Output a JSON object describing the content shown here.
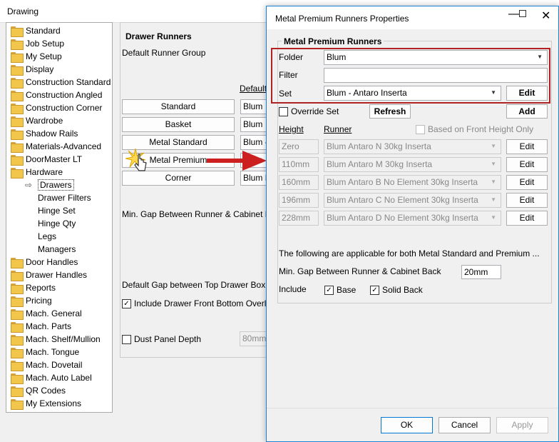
{
  "window": {
    "title": "Drawing"
  },
  "tree": {
    "items": [
      {
        "label": "Standard",
        "type": "folder"
      },
      {
        "label": "Job Setup",
        "type": "folder"
      },
      {
        "label": "My Setup",
        "type": "folder"
      },
      {
        "label": "Display",
        "type": "folder"
      },
      {
        "label": "Construction Standard",
        "type": "folder"
      },
      {
        "label": "Construction Angled",
        "type": "folder"
      },
      {
        "label": "Construction Corner",
        "type": "folder"
      },
      {
        "label": "Wardrobe",
        "type": "folder"
      },
      {
        "label": "Shadow Rails",
        "type": "folder"
      },
      {
        "label": "Materials-Advanced",
        "type": "folder"
      },
      {
        "label": "DoorMaster LT",
        "type": "folder"
      },
      {
        "label": "Hardware",
        "type": "folder"
      },
      {
        "label": "Drawers",
        "type": "child-selected"
      },
      {
        "label": "Drawer Filters",
        "type": "child"
      },
      {
        "label": "Hinge Set",
        "type": "child"
      },
      {
        "label": "Hinge Qty",
        "type": "child"
      },
      {
        "label": "Legs",
        "type": "child"
      },
      {
        "label": "Managers",
        "type": "child"
      },
      {
        "label": "Door Handles",
        "type": "folder"
      },
      {
        "label": "Drawer Handles",
        "type": "folder"
      },
      {
        "label": "Reports",
        "type": "folder"
      },
      {
        "label": "Pricing",
        "type": "folder"
      },
      {
        "label": "Mach. General",
        "type": "folder"
      },
      {
        "label": "Mach. Parts",
        "type": "folder"
      },
      {
        "label": "Mach. Shelf/Mullion",
        "type": "folder"
      },
      {
        "label": "Mach. Tongue",
        "type": "folder"
      },
      {
        "label": "Mach. Dovetail",
        "type": "folder"
      },
      {
        "label": "Mach. Auto Label",
        "type": "folder"
      },
      {
        "label": "QR Codes",
        "type": "folder"
      },
      {
        "label": "My Extensions",
        "type": "folder"
      }
    ]
  },
  "runners_panel": {
    "title": "Drawer Runners",
    "default_group_label": "Default Runner Group",
    "default_col": "Default",
    "rows": [
      {
        "button": "Standard",
        "value": "Blum"
      },
      {
        "button": "Basket",
        "value": "Blum"
      },
      {
        "button": "Metal Standard",
        "value": "Blum -"
      },
      {
        "button": "Metal Premium",
        "value": "Blum -"
      },
      {
        "button": "Corner",
        "value": "Blum In"
      }
    ],
    "min_gap_label": "Min. Gap Between Runner & Cabinet Back",
    "default_gap_label": "Default Gap between Top Drawer Box & Ca",
    "include_overlap_label": "Include Drawer Front Bottom Overlap in",
    "include_overlap_checked": "✓",
    "dust_panel_label": "Dust Panel Depth",
    "dust_panel_value": "80mm"
  },
  "dialog": {
    "title": "Metal Premium Runners Properties",
    "group_title": "Metal Premium Runners",
    "folder_label": "Folder",
    "folder_value": "Blum",
    "filter_label": "Filter",
    "filter_value": "",
    "set_label": "Set",
    "set_value": "Blum - Antaro Inserta",
    "edit_label": "Edit",
    "override_label": "Override Set",
    "refresh_label": "Refresh",
    "add_label": "Add",
    "height_header": "Height",
    "runner_header": "Runner",
    "based_on_front_label": "Based on Front Height Only",
    "rows": [
      {
        "height": "Zero",
        "runner": "Blum Antaro N 30kg Inserta",
        "edit": "Edit"
      },
      {
        "height": "110mm",
        "runner": "Blum Antaro M 30kg Inserta",
        "edit": "Edit"
      },
      {
        "height": "160mm",
        "runner": "Blum Antaro B No Element 30kg Inserta",
        "edit": "Edit"
      },
      {
        "height": "196mm",
        "runner": "Blum Antaro C No Element 30kg Inserta",
        "edit": "Edit"
      },
      {
        "height": "228mm",
        "runner": "Blum Antaro D No Element 30kg Inserta",
        "edit": "Edit"
      }
    ],
    "applicable_note": "The following are applicable for both Metal Standard and Premium ...",
    "min_gap_label": "Min. Gap Between Runner & Cabinet Back",
    "min_gap_value": "20mm",
    "include_label": "Include",
    "base_label": "Base",
    "solid_back_label": "Solid Back",
    "check_mark": "✓",
    "ok_label": "OK",
    "cancel_label": "Cancel",
    "apply_label": "Apply"
  },
  "colors": {
    "highlight_border": "#b22222",
    "accent_blue": "#1883d7",
    "arrow_red": "#cc1f1f"
  }
}
